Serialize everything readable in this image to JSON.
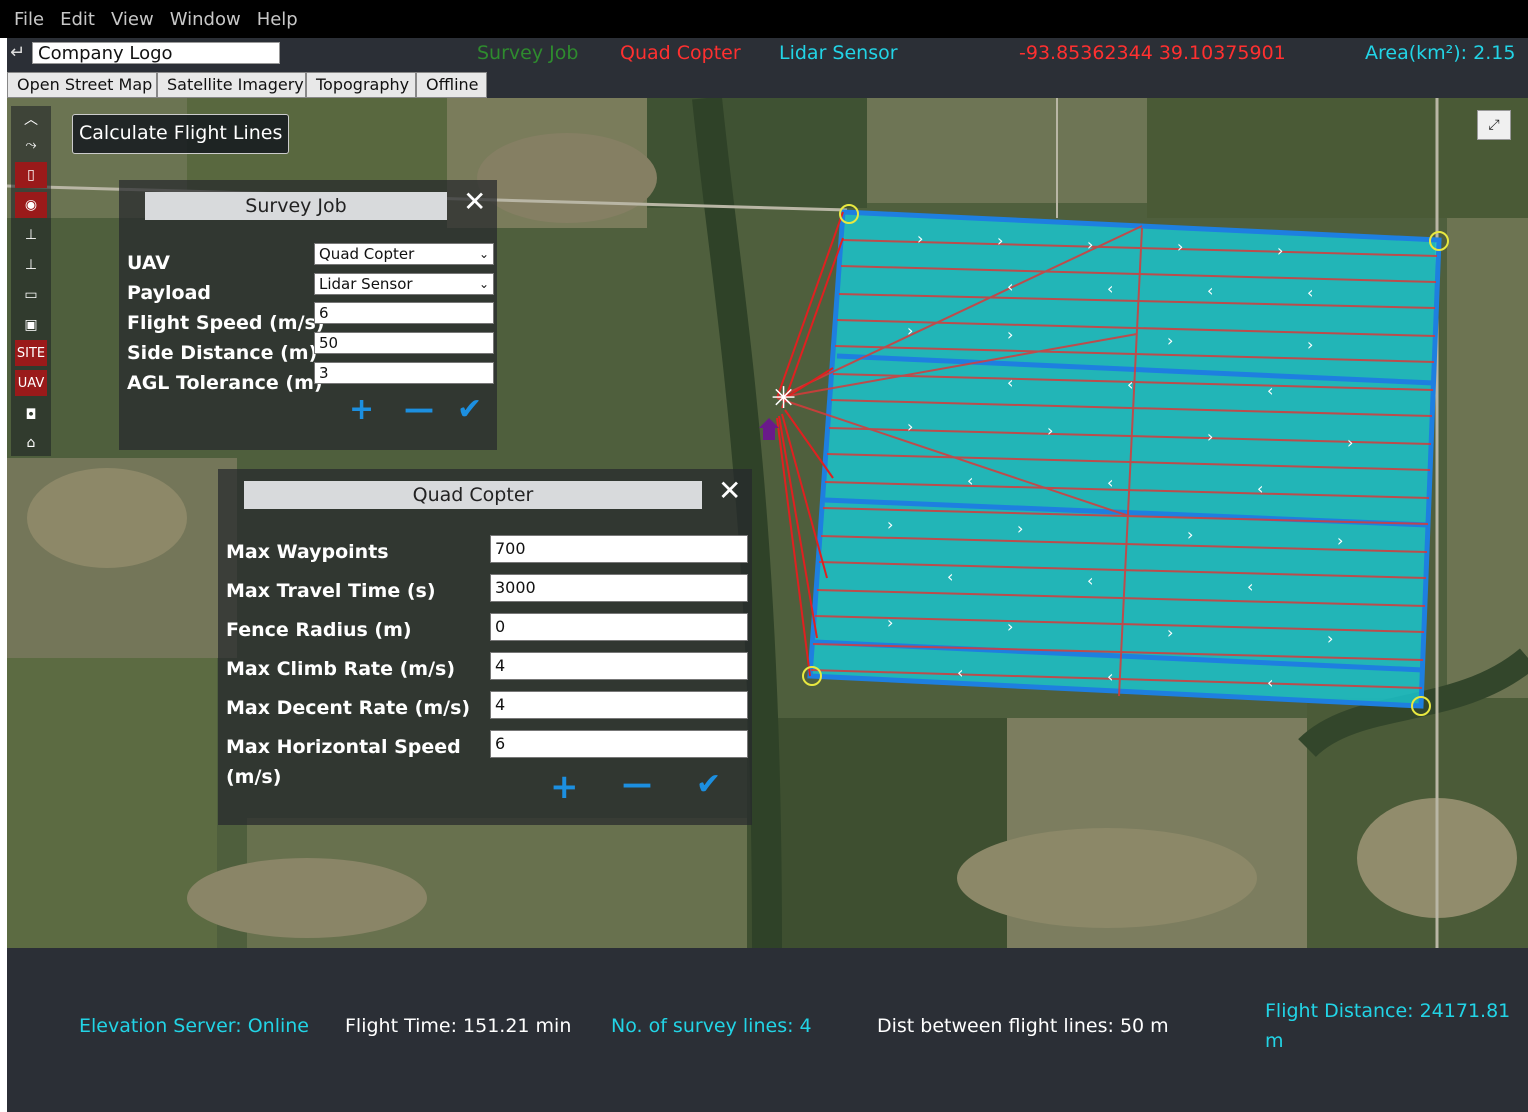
{
  "menu": [
    "File",
    "Edit",
    "View",
    "Window",
    "Help"
  ],
  "header": {
    "logo_value": "Company Logo",
    "job": "Survey Job",
    "uav": "Quad Copter",
    "sensor": "Lidar Sensor",
    "coordinates": "-93.85362344 39.10375901",
    "area_label": "Area(km²): 2.15"
  },
  "map_tabs": [
    "Open Street Map",
    "Satellite Imagery",
    "Topography",
    "Offline"
  ],
  "toolbar": {
    "items": [
      "up-icon",
      "route-icon",
      "map-icon",
      "location-pin-icon",
      "drone-icon",
      "drone-icon",
      "folder-icon",
      "save-icon",
      "SITE",
      "UAV",
      "camera-icon",
      "home-icon"
    ]
  },
  "calc_button": "Calculate Flight Lines",
  "survey_job": {
    "title": "Survey Job",
    "uav_label": "UAV",
    "uav_value": "Quad Copter",
    "payload_label": "Payload",
    "payload_value": "Lidar Sensor",
    "speed_label": "Flight Speed (m/s)",
    "speed_value": "6",
    "side_label": "Side Distance (m)",
    "side_value": "50",
    "agl_label": "AGL Tolerance (m)",
    "agl_value": "3"
  },
  "quad_copter": {
    "title": "Quad Copter",
    "waypoints_label": "Max Waypoints",
    "waypoints_value": "700",
    "travel_label": "Max Travel Time (s)",
    "travel_value": "3000",
    "fence_label": "Fence Radius (m)",
    "fence_value": "0",
    "climb_label": "Max Climb Rate (m/s)",
    "climb_value": "4",
    "decent_label": "Max Decent Rate (m/s)",
    "decent_value": "4",
    "hspeed_label_1": "Max Horizontal Speed",
    "hspeed_label_2": "(m/s)",
    "hspeed_value": "6"
  },
  "status": {
    "elevation": "Elevation Server: Online",
    "flight_time": "Flight Time: 151.21 min",
    "lines": "No. of survey lines: 4",
    "dist": "Dist between flight lines: 50 m",
    "flight_dist_1": "Flight Distance: 24171.81",
    "flight_dist_2": "m"
  },
  "colors": {
    "accent_green": "#2e8b2e",
    "accent_red": "#ff3030",
    "accent_cyan": "#22d4e6",
    "survey_fill": "#19c8d2",
    "survey_border": "#1e7fe0",
    "flight_line": "#e03030"
  }
}
